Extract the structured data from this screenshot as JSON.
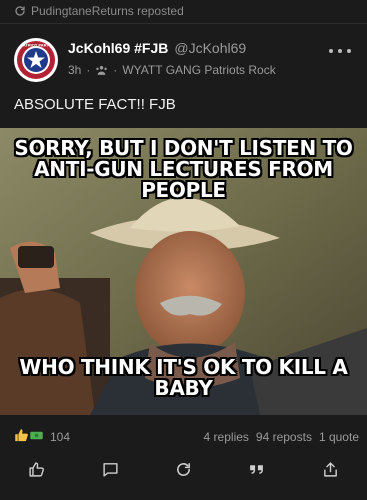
{
  "repost": {
    "icon": "repost-icon",
    "text": "PudingtaneReturns reposted"
  },
  "post": {
    "author_name": "JcKohl69 #FJB",
    "handle": "@JcKohl69",
    "time": "3h",
    "separator": "·",
    "group_icon": "group-icon",
    "group_name": "WYATT GANG Patriots Rock",
    "avatar_text": "PATRIOT PARTY",
    "text": "ABSOLUTE FACT!! FJB"
  },
  "meme": {
    "top_lines": [
      "SORRY, BUT I DON'T LISTEN TO",
      "ANTI-GUN LECTURES FROM",
      "PEOPLE"
    ],
    "bottom_lines": [
      "WHO THINK IT'S OK TO KILL A",
      "BABY"
    ]
  },
  "stats": {
    "reaction_icons": [
      "thumbs-up-emoji",
      "money-emoji"
    ],
    "reaction_count": "104",
    "replies": "4 replies",
    "reposts": "94 reposts",
    "quotes": "1 quote"
  },
  "actions": [
    "like-icon",
    "reply-icon",
    "repost-icon",
    "quote-icon",
    "share-icon"
  ],
  "colors": {
    "background": "#1b1b1b",
    "text": "#e6e6e6",
    "muted": "#9a9a9a"
  }
}
